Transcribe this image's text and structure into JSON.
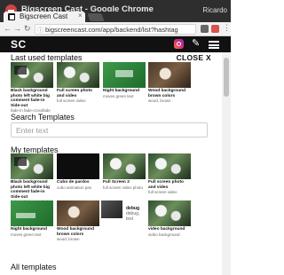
{
  "window": {
    "title": "Bigscreen Cast - Google Chrome"
  },
  "tab": {
    "title": "Bigscreen Cast",
    "close": "×"
  },
  "user": {
    "name": "Ricardo"
  },
  "address": {
    "url": "bigscreencast.com/app/backend/list?hashtag",
    "back": "←",
    "forward": "→",
    "reload": "↻",
    "lock": "🔒"
  },
  "app": {
    "logo": "SC",
    "tools_icon": "✎"
  },
  "last_used": {
    "title": "Last used templates",
    "close": "CLOSE X",
    "items": [
      {
        "name": "Black background photo left white big comment fade-in Side-out",
        "sub": "fade-in fade-crossfade"
      },
      {
        "name": "Full screen photo and video",
        "sub": "full screen video"
      },
      {
        "name": "Night background",
        "sub": "moves green text"
      },
      {
        "name": "Wood background brown colors",
        "sub": "wood, brown"
      }
    ]
  },
  "search": {
    "title": "Search Templates",
    "placeholder": "Enter text"
  },
  "my_templates": {
    "title": "My templates",
    "row1": [
      {
        "name": "Black background photo left white big comment fade-in Side-out",
        "sub": "fade-in fade-crossfade"
      },
      {
        "name": "Cubo de pardos",
        "sub": "cubo animation pas"
      },
      {
        "name": "Full Screen 2",
        "sub": "full screen video photo"
      },
      {
        "name": "Full screen photo and video",
        "sub": "full screen video"
      }
    ],
    "row2": [
      {
        "name": "Night background",
        "sub": "moves green text"
      },
      {
        "name": "Wood background brown colors",
        "sub": "wood, brown"
      },
      {
        "name": "debug",
        "sub": "debug, test"
      },
      {
        "name": "video background",
        "sub": "video background"
      }
    ]
  },
  "all_templates": {
    "title": "All templates"
  }
}
